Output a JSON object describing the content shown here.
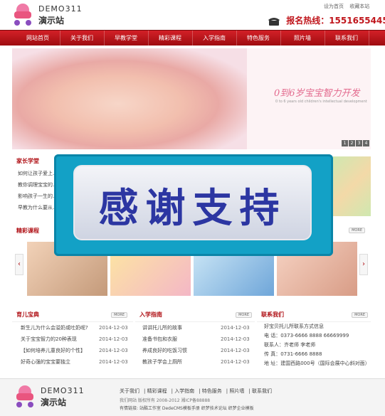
{
  "header": {
    "brand": "DEMO311",
    "sub": "演示站",
    "toplinks": [
      "设为首页",
      "收藏本站"
    ],
    "hotline_label": "报名热线：",
    "hotline_number": "15516554455"
  },
  "nav": [
    "网站首页",
    "关于我们",
    "早教学堂",
    "精彩课程",
    "入学指南",
    "特色服务",
    "照片墙",
    "联系我们"
  ],
  "banner": {
    "tagline": "0到6岁宝宝智力开发",
    "tagline_en": "0 to 6 years old children's intellectual development",
    "pager": [
      "1",
      "2",
      "3",
      "4"
    ]
  },
  "parents": {
    "title": "家长学堂",
    "items": [
      "如何让孩子爱上...",
      "教你调理宝宝的...",
      "影响孩子一生的...",
      "早教为什么要从..."
    ]
  },
  "overlay": {
    "text": "感谢支持"
  },
  "courses": {
    "title": "精彩课程",
    "more": "MORE",
    "prev": "‹",
    "next": "›"
  },
  "baby_book": {
    "title": "育儿宝典",
    "more": "MORE",
    "items": [
      {
        "title": "新生儿为什么会溢奶或吐奶呢?",
        "date": "2014-12-03"
      },
      {
        "title": "关于宝宝智力的20种表现",
        "date": "2014-12-03"
      },
      {
        "title": "【如何培养儿童良好的个性】",
        "date": "2014-12-03"
      },
      {
        "title": "好奇心强的宝宝要独立",
        "date": "2014-12-03"
      }
    ]
  },
  "guide": {
    "title": "入学指南",
    "more": "MORE",
    "items": [
      {
        "title": "讲讲托儿所的故事",
        "date": "2014-12-03"
      },
      {
        "title": "准备书包和衣服",
        "date": "2014-12-03"
      },
      {
        "title": "养成良好的吃饭习惯",
        "date": "2014-12-03"
      },
      {
        "title": "教孩子学会上厕所",
        "date": "2014-12-03"
      }
    ]
  },
  "contact": {
    "title": "联系我们",
    "more": "MORE",
    "lines": [
      "好宝贝托儿所联系方式信息",
      "电  话：0373-6666 8888  66669999",
      "联系人：齐老师      李老师",
      "传  真：0731-6666 8888",
      "地  址：建国西路000号（国际会展中心斜对面）"
    ]
  },
  "footer": {
    "brand": "DEMO311",
    "sub": "演示站",
    "links": [
      "关于我们",
      "精彩课程",
      "入学指南",
      "特色服务",
      "照片墙",
      "联系我们"
    ],
    "copyright": "我们网站 版权所有 2008-2012 湘ICP备88888",
    "friend_label": "有情链接:",
    "friends": "站酷工作室 DedeCMS模板手册 织梦技术论坛 织梦企业模板"
  },
  "colors": {
    "primary": "#c0161c",
    "nav": "#b01217",
    "overlay": "#13a1c6"
  }
}
